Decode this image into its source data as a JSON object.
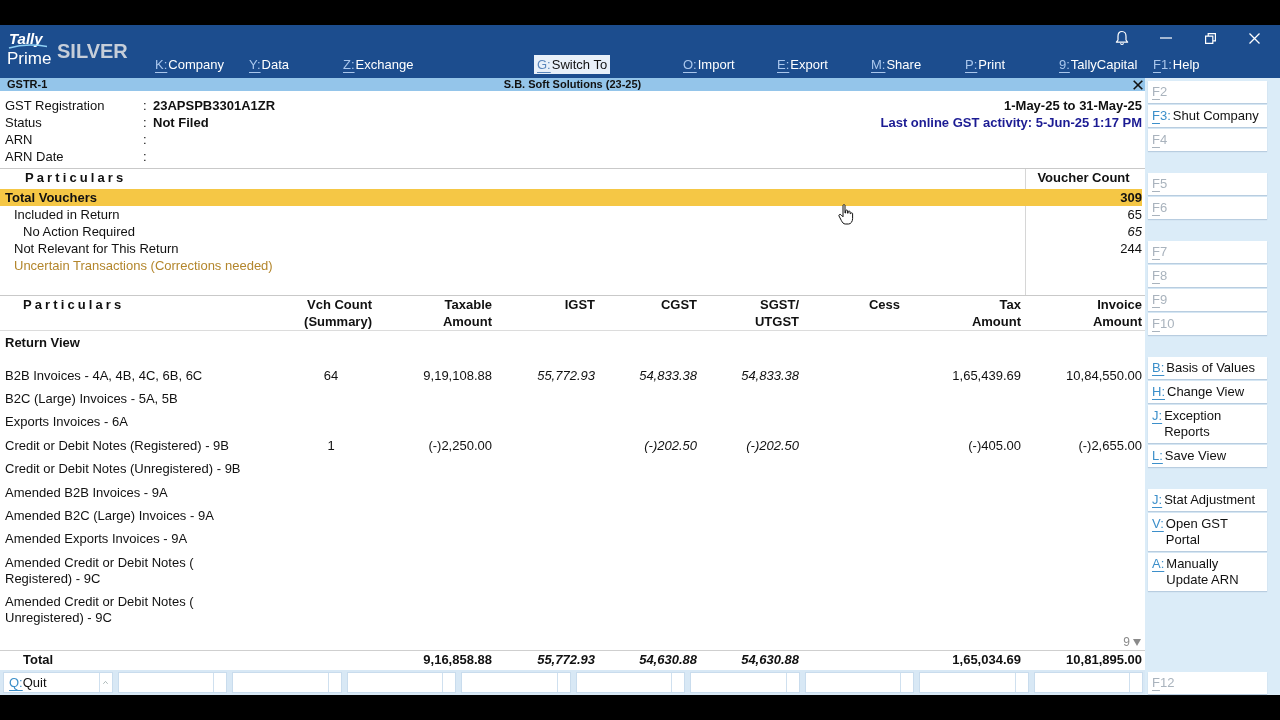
{
  "logo": {
    "brand": "Tally",
    "product": "Prime",
    "edition": "SILVER"
  },
  "menu": [
    [
      {
        "key": "K:",
        "label": "Company",
        "selected": false
      },
      {
        "key": "Y:",
        "label": "Data",
        "selected": false
      },
      {
        "key": "Z:",
        "label": "Exchange",
        "selected": false
      }
    ],
    [
      {
        "key": "G:",
        "label": "Switch To",
        "selected": true
      }
    ],
    [
      {
        "key": "O:",
        "label": "Import",
        "selected": false
      },
      {
        "key": "E:",
        "label": "Export",
        "selected": false
      },
      {
        "key": "M:",
        "label": "Share",
        "selected": false
      },
      {
        "key": "P:",
        "label": "Print",
        "selected": false
      },
      {
        "key": "9:",
        "label": "TallyCapital",
        "selected": false
      },
      {
        "key": "F1:",
        "label": "Help",
        "selected": false
      }
    ]
  ],
  "report_bar": {
    "title": "GSTR-1",
    "company": "S.B. Soft Solutions (23-25)"
  },
  "details": [
    {
      "label": "GST Registration",
      "separator": ":",
      "value": "23APSPB3301A1ZR"
    },
    {
      "label": "Status",
      "separator": ":",
      "value": "Not Filed"
    },
    {
      "label": "ARN",
      "separator": ":"
    },
    {
      "label": "ARN Date",
      "separator": ":"
    }
  ],
  "period": "1-May-25 to 31-May-25",
  "last_activity": "Last online GST activity: 5-Jun-25 1:17 PM",
  "summary": {
    "columns": [
      "Particulars",
      "Voucher Count"
    ],
    "rows": [
      {
        "label": "Total Vouchers",
        "count": "309",
        "selected": true,
        "kind": "plain",
        "children": [
          {
            "label": "Included in Return",
            "count": "65",
            "selected": false,
            "kind": "plain",
            "children": [
              {
                "label": "No Action Required",
                "count": "65",
                "selected": false,
                "kind": "italic"
              }
            ]
          },
          {
            "label": "Not Relevant for This Return",
            "count": "244",
            "selected": false,
            "kind": "plain"
          },
          {
            "label": "Uncertain Transactions (Corrections needed)",
            "selected": false,
            "kind": "alert"
          }
        ]
      }
    ]
  },
  "return_table": {
    "columns": [
      {
        "label": "Particulars"
      },
      {
        "label": "Vch Count\n(Summary)"
      },
      {
        "label": "Taxable\nAmount"
      },
      {
        "label": "IGST",
        "italic": true
      },
      {
        "label": "CGST",
        "italic": true
      },
      {
        "label": "SGST/\nUTGST",
        "italic": true
      },
      {
        "label": "Cess"
      },
      {
        "label": "Tax\nAmount"
      },
      {
        "label": "Invoice\nAmount"
      }
    ],
    "section": "Return View",
    "rows": [
      {
        "label": "B2B Invoices - 4A, 4B, 4C, 6B, 6C",
        "cells": [
          "64",
          "9,19,108.88",
          "55,772.93",
          "54,833.38",
          "54,833.38",
          null,
          "1,65,439.69",
          "10,84,550.00"
        ]
      },
      {
        "label": "B2C (Large) Invoices - 5A, 5B"
      },
      {
        "label": "Exports Invoices - 6A"
      },
      {
        "label": "Credit or Debit Notes (Registered) - 9B",
        "cells": [
          "1",
          "(-)2,250.00",
          null,
          "(-)202.50",
          "(-)202.50",
          null,
          "(-)405.00",
          "(-)2,655.00"
        ]
      },
      {
        "label": "Credit or Debit Notes (Unregistered) - 9B"
      },
      {
        "label": "Amended B2B Invoices - 9A"
      },
      {
        "label": "Amended B2C (Large) Invoices - 9A"
      },
      {
        "label": "Amended Exports Invoices - 9A"
      },
      {
        "label": "Amended Credit or Debit Notes (\nRegistered) - 9C"
      },
      {
        "label": "Amended Credit or Debit Notes (\nUnregistered) - 9C"
      }
    ],
    "more_rows": "9",
    "total": {
      "label": "Total",
      "cells": [
        null,
        "9,16,858.88",
        "55,772.93",
        "54,630.88",
        "54,630.88",
        null,
        "1,65,034.69",
        "10,81,895.00"
      ]
    }
  },
  "sidebar": [
    [
      {
        "key": "F2",
        "disabled": true
      },
      {
        "key": "F3:",
        "label": "Shut Company",
        "disabled": false
      },
      {
        "key": "F4",
        "disabled": true
      }
    ],
    [
      {
        "key": "F5",
        "disabled": true
      },
      {
        "key": "F6",
        "disabled": true
      }
    ],
    [
      {
        "key": "F7",
        "disabled": true
      },
      {
        "key": "F8",
        "disabled": true
      },
      {
        "key": "F9",
        "disabled": true
      },
      {
        "key": "F10",
        "disabled": true
      }
    ],
    [
      {
        "key": "B:",
        "label": "Basis of Values",
        "disabled": false
      },
      {
        "key": "H:",
        "label": "Change View",
        "disabled": false
      },
      {
        "key": "J:",
        "label": "Exception\nReports",
        "disabled": false
      },
      {
        "key": "L:",
        "label": "Save View",
        "disabled": false
      }
    ],
    [
      {
        "key": "J:",
        "label": "Stat Adjustment",
        "disabled": false
      },
      {
        "key": "V:",
        "label": "Open GST\nPortal",
        "disabled": false
      },
      {
        "key": "A:",
        "label": "Manually\nUpdate ARN",
        "disabled": false
      }
    ]
  ],
  "sidebar_bottom": {
    "key": "F12",
    "disabled": true
  },
  "footer": [
    {
      "key": "Q:",
      "label": "Quit"
    }
  ]
}
